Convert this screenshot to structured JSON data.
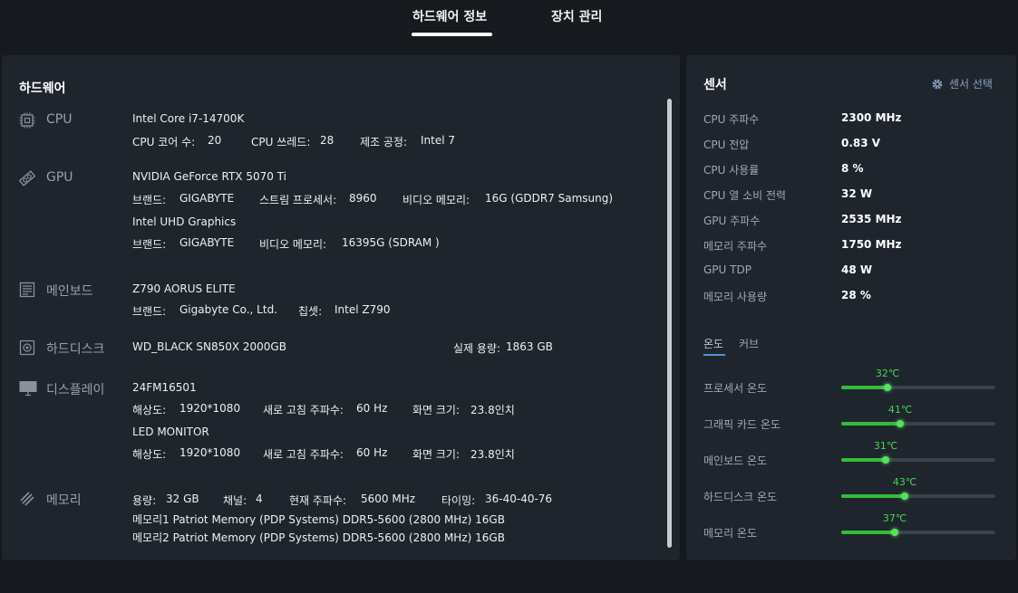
{
  "tabs": {
    "hardware_info": "하드웨어 정보",
    "device_manager": "장치 관리"
  },
  "hardware": {
    "title": "하드웨어",
    "cpu": {
      "label": "CPU",
      "name": "Intel Core i7-14700K",
      "cores_label": "CPU 코어 수:",
      "cores": "20",
      "threads_label": "CPU 쓰레드:",
      "threads": "28",
      "process_label": "제조 공정:",
      "process": "Intel 7"
    },
    "gpu": {
      "label": "GPU",
      "gpu1_name": "NVIDIA GeForce RTX 5070 Ti",
      "gpu1_brand_label": "브랜드:",
      "gpu1_brand": "GIGABYTE",
      "gpu1_sp_label": "스트림 프로세서:",
      "gpu1_sp": "8960",
      "gpu1_vram_label": "비디오 메모리:",
      "gpu1_vram": "16G (GDDR7 Samsung)",
      "gpu2_name": "Intel UHD Graphics",
      "gpu2_brand_label": "브랜드:",
      "gpu2_brand": "GIGABYTE",
      "gpu2_vram_label": "비디오 메모리:",
      "gpu2_vram": "16395G (SDRAM )"
    },
    "motherboard": {
      "label": "메인보드",
      "name": "Z790 AORUS ELITE",
      "brand_label": "브랜드:",
      "brand": "Gigabyte Co., Ltd.",
      "chipset_label": "칩셋:",
      "chipset": "Intel Z790"
    },
    "disk": {
      "label": "하드디스크",
      "name": "WD_BLACK SN850X 2000GB",
      "capacity_label": "실제 용량:",
      "capacity": "1863 GB"
    },
    "display": {
      "label": "디스플레이",
      "d1_name": "24FM16501",
      "d1_res_label": "해상도:",
      "d1_res": "1920*1080",
      "d1_refresh_label": "새로 고침 주파수:",
      "d1_refresh": "60 Hz",
      "d1_size_label": "화면 크기:",
      "d1_size": "23.8인치",
      "d2_name": "LED MONITOR",
      "d2_res_label": "해상도:",
      "d2_res": "1920*1080",
      "d2_refresh_label": "새로 고침 주파수:",
      "d2_refresh": "60 Hz",
      "d2_size_label": "화면 크기:",
      "d2_size": "23.8인치"
    },
    "memory": {
      "label": "메모리",
      "size_label": "용량:",
      "size": "32 GB",
      "channel_label": "채널:",
      "channel": "4",
      "freq_label": "현재 주파수:",
      "freq": "5600 MHz",
      "timing_label": "타이밍:",
      "timing": "36-40-40-76",
      "slot1": "메모리1  Patriot Memory (PDP Systems) DDR5-5600 (2800 MHz) 16GB",
      "slot2": "메모리2  Patriot Memory (PDP Systems) DDR5-5600 (2800 MHz) 16GB"
    }
  },
  "sensors": {
    "title": "센서",
    "select_label": "센서 선택",
    "readings": [
      {
        "label": "CPU 주파수",
        "value": "2300 MHz"
      },
      {
        "label": "CPU 전압",
        "value": "0.83 V"
      },
      {
        "label": "CPU 사용률",
        "value": "8 %"
      },
      {
        "label": "CPU 열 소비 전력",
        "value": "32 W"
      },
      {
        "label": "GPU 주파수",
        "value": "2535 MHz"
      },
      {
        "label": "메모리 주파수",
        "value": "1750 MHz"
      },
      {
        "label": "GPU TDP",
        "value": "48 W"
      },
      {
        "label": "메모리 사용량",
        "value": "28 %"
      }
    ],
    "subtabs": {
      "temperature": "온도",
      "curve": "커브"
    },
    "temperatures": [
      {
        "label": "프로세서 온도",
        "value": "32℃",
        "level": 0.3
      },
      {
        "label": "그래픽 카드 온도",
        "value": "41℃",
        "level": 0.38
      },
      {
        "label": "메인보드 온도",
        "value": "31℃",
        "level": 0.29
      },
      {
        "label": "하드디스크 온도",
        "value": "43℃",
        "level": 0.41
      },
      {
        "label": "메모리 온도",
        "value": "37℃",
        "level": 0.35
      }
    ],
    "accent_color": "#2fbe3a"
  }
}
